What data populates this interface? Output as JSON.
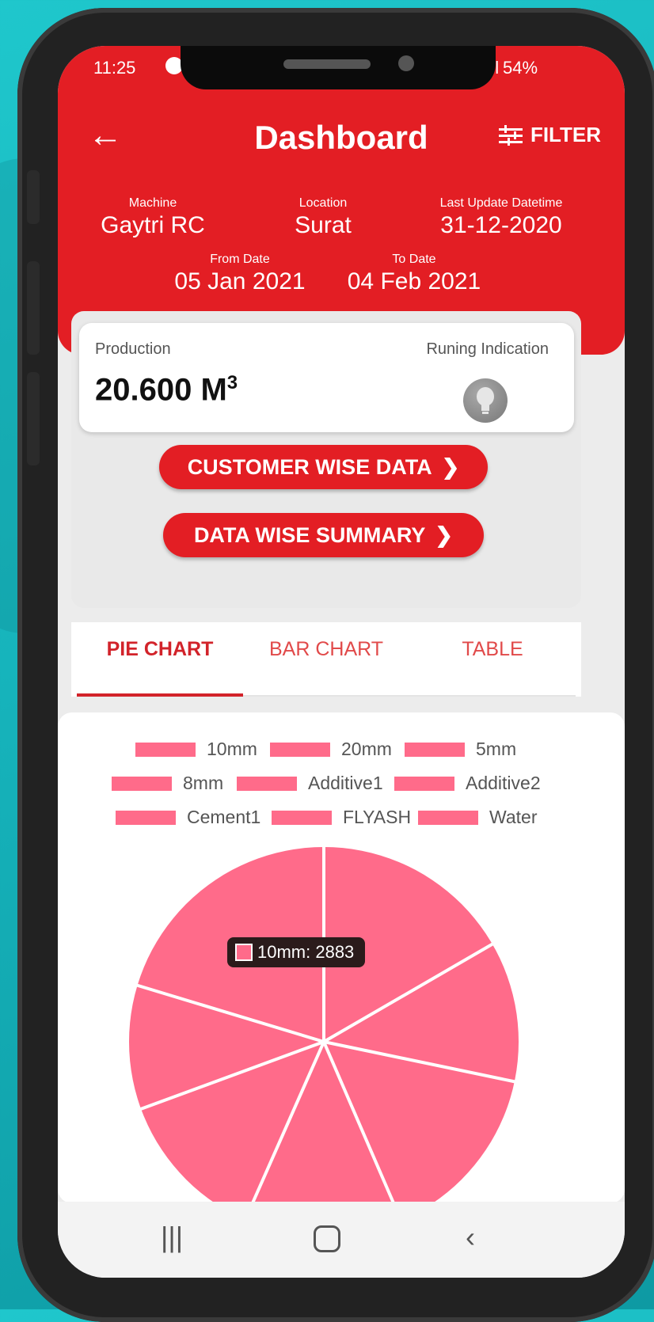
{
  "status": {
    "time": "11:25",
    "battery": "54%"
  },
  "header": {
    "title": "Dashboard",
    "filter_label": "FILTER"
  },
  "info": {
    "machine_label": "Machine",
    "machine": "Gaytri RC",
    "location_label": "Location",
    "location": "Surat",
    "last_update_label": "Last Update Datetime",
    "last_update": "31-12-2020",
    "from_label": "From Date",
    "from": "05 Jan 2021",
    "to_label": "To Date",
    "to": "04 Feb 2021"
  },
  "production": {
    "label": "Production",
    "value": "20.600 M",
    "unit_sup": "3",
    "running_label": "Runing Indication"
  },
  "buttons": {
    "customer": "CUSTOMER WISE DATA",
    "data_summary": "DATA WISE SUMMARY"
  },
  "tabs": [
    "PIE CHART",
    "BAR CHART",
    "TABLE"
  ],
  "colors": {
    "header": "#e31e24",
    "pie": "#ff6b8a"
  },
  "chart_data": {
    "type": "pie",
    "legend": [
      "10mm",
      "20mm",
      "5mm",
      "8mm",
      "Additive1",
      "Additive2",
      "Cement1",
      "FLYASH",
      "Water"
    ],
    "values": [
      {
        "label": "10mm",
        "value": 2883
      }
    ],
    "tooltip": "10mm: 2883"
  }
}
